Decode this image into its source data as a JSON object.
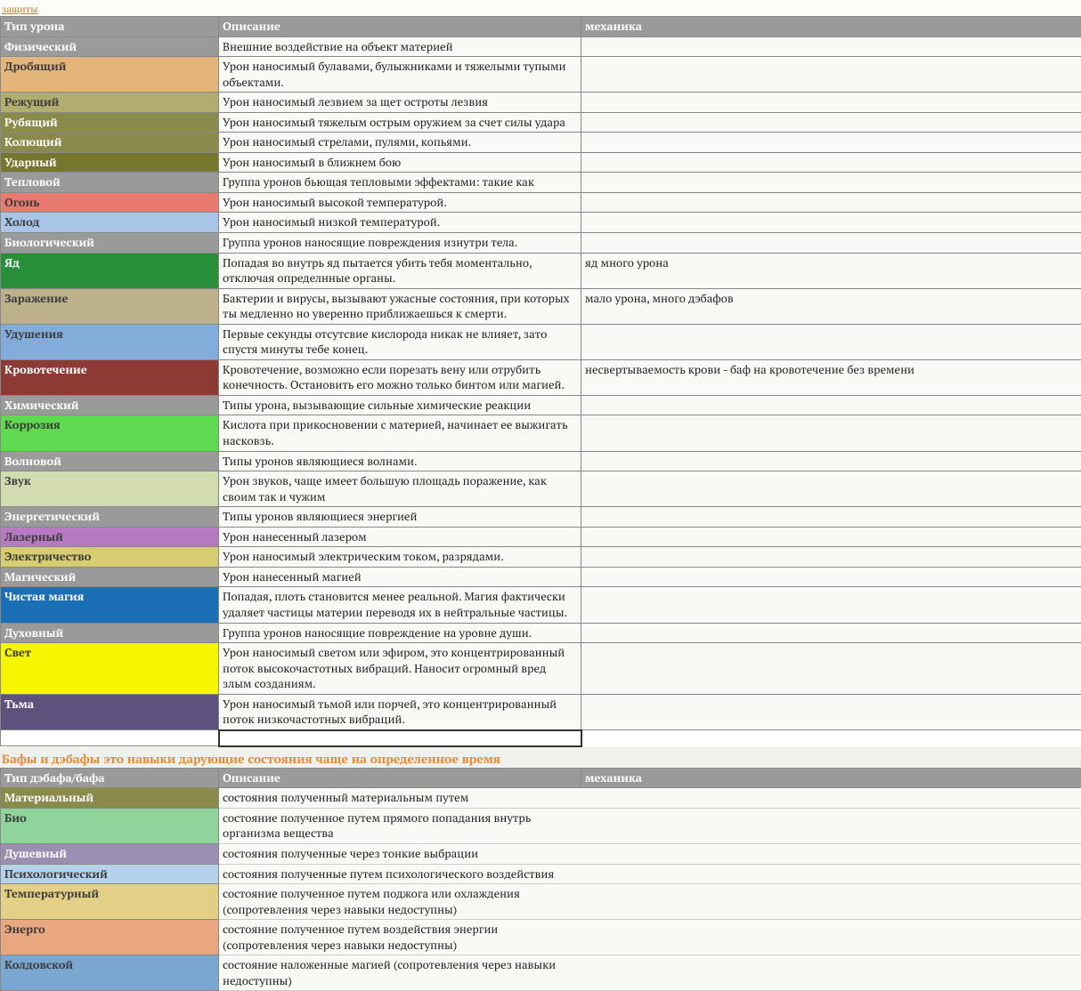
{
  "top_link": "защиты",
  "table1": {
    "headers": [
      "Тип урона",
      "Описание",
      "механика"
    ],
    "rows": [
      {
        "label": "Физический",
        "desc": "Внешние воздействие на объект материей",
        "mech": "",
        "bg": "#9a9a9a",
        "txt": "white"
      },
      {
        "label": "Дробящий",
        "desc": "Урон наносимый булавами, булыжниками и тяжелыми тупыми объектами.",
        "mech": "",
        "bg": "#e3b57a",
        "txt": "dark"
      },
      {
        "label": "Режущий",
        "desc": "Урон наносимый лезвием за щет остроты лезвия",
        "mech": "",
        "bg": "#b0ad6e",
        "txt": "dark"
      },
      {
        "label": "Рубящий",
        "desc": "Урон наносимый тяжелым острым оружием за счет силы удара",
        "mech": "",
        "bg": "#8a8a4a",
        "txt": "white"
      },
      {
        "label": "Колющий",
        "desc": "Урон наносимый стрелами, пулями, копьями.",
        "mech": "",
        "bg": "#8a8a4a",
        "txt": "white"
      },
      {
        "label": "Ударный",
        "desc": "Урон наносимый в ближнем бою",
        "mech": "",
        "bg": "#76762e",
        "txt": "white"
      },
      {
        "label": "Тепловой",
        "desc": "Группа уронов бьющая тепловыми эффектами: такие как",
        "mech": "",
        "bg": "#9a9a9a",
        "txt": "white"
      },
      {
        "label": "Огонь",
        "desc": "Урон наносимый высокой температурой.",
        "mech": "",
        "bg": "#e87a70",
        "txt": "dark"
      },
      {
        "label": "Холод",
        "desc": "Урон наносимый низкой температурой.",
        "mech": "",
        "bg": "#a8c4e6",
        "txt": "dark"
      },
      {
        "label": "Биологический",
        "desc": "Группа уронов наносящие повреждения изнутри тела.",
        "mech": "",
        "bg": "#9a9a9a",
        "txt": "white"
      },
      {
        "label": "Яд",
        "desc": "Попадая во внутрь яд пытается убить тебя моментально, отключая определнные органы.",
        "mech": "яд много урона",
        "bg": "#2a8f3a",
        "txt": "white"
      },
      {
        "label": "Заражение",
        "desc": "Бактерии и вирусы, вызывают ужасные состояния, при которых ты медленно но уверенно приближаешься к смерти.",
        "mech": "мало урона, много дэбафов",
        "bg": "#bdb18b",
        "txt": "dark"
      },
      {
        "label": "Удушения",
        "desc": "Первые секунды отсутсвие кислорода никак не влияет, зато спустя минуты тебе конец.",
        "mech": "",
        "bg": "#82acd9",
        "txt": "dark"
      },
      {
        "label": "Кровотечение",
        "desc": "Кровотечение, возможно если порезать вену или отрубить конечность. Остановить его можно только бинтом или магией.",
        "mech": "несвертываемость крови - баф на кровотечение без времени",
        "bg": "#8e3a34",
        "txt": "white"
      },
      {
        "label": "Химический",
        "desc": "Типы урона, вызывающие сильные химические реакции",
        "mech": "",
        "bg": "#9a9a9a",
        "txt": "white"
      },
      {
        "label": "Коррозия",
        "desc": "Кислота при прикосновении с материей, начинает ее выжигать насковзь.",
        "mech": "",
        "bg": "#5fd94f",
        "txt": "dark"
      },
      {
        "label": "Волновой",
        "desc": "Типы уронов являющиеся волнами.",
        "mech": "",
        "bg": "#9a9a9a",
        "txt": "white"
      },
      {
        "label": "Звук",
        "desc": "Урон звуков, чаще имеет большую площадь поражение, как своим так и чужим",
        "mech": "",
        "bg": "#d2dcb0",
        "txt": "dark"
      },
      {
        "label": "Энергетический",
        "desc": "Типы уронов являющиеся энергией",
        "mech": "",
        "bg": "#9a9a9a",
        "txt": "white"
      },
      {
        "label": "Лазерный",
        "desc": "Урон нанесенный лазером",
        "mech": "",
        "bg": "#b57ac1",
        "txt": "dark"
      },
      {
        "label": "Электричество",
        "desc": "Урон наносимый электрическим током, разрядами.",
        "mech": "",
        "bg": "#d6cc70",
        "txt": "dark"
      },
      {
        "label": "Магический",
        "desc": "Урон нанесенный магией",
        "mech": "",
        "bg": "#9a9a9a",
        "txt": "white"
      },
      {
        "label": "Чистая магия",
        "desc": "Попадая, плоть становится менее реальной. Магия фактически удаляет частицы материи переводя их в нейтральные частицы.",
        "mech": "",
        "bg": "#1a6fb5",
        "txt": "white"
      },
      {
        "label": "Духовный",
        "desc": "Группа уронов наносящие повреждение на уровне души.",
        "mech": "",
        "bg": "#9a9a9a",
        "txt": "white"
      },
      {
        "label": "Свет",
        "desc": "Урон наносимый светом или эфиром, это концентрированный поток высокочастотных вибраций. Наносит огромный вред злым созданиям.",
        "mech": "",
        "bg": "#f6f600",
        "txt": "dark"
      },
      {
        "label": "Тьма",
        "desc": "Урон наносимый тьмой или порчей, это концентрированный поток низкочастотных вибраций.",
        "mech": "",
        "bg": "#5d517d",
        "txt": "white"
      }
    ]
  },
  "section2_title": "Бафы и дэбафы это навыки дарующие состояния чаще на определенное время",
  "table2": {
    "headers": [
      "Тип дэбафа/бафа",
      "Описание",
      "механика"
    ],
    "rows": [
      {
        "label": "Материальный",
        "desc": "состояния полученный материальным путем",
        "mech": "",
        "bg": "#8a8a4a",
        "txt": "white"
      },
      {
        "label": "Био",
        "desc": "состояние полученное путем прямого попадания внутрь организма вещества",
        "mech": "",
        "bg": "#8fd49a",
        "txt": "dark"
      },
      {
        "label": "Душевный",
        "desc": "состояния полученные через тонкие выбрации",
        "mech": "",
        "bg": "#9a8fb0",
        "txt": "white"
      },
      {
        "label": "Психологический",
        "desc": "состояния полученные путем психологического воздействия",
        "mech": "",
        "bg": "#b4d3ea",
        "txt": "dark"
      },
      {
        "label": "Температурный",
        "desc": "состояние полученное путем поджога или охлаждения (сопротевления через навыки недоступны)",
        "mech": "",
        "bg": "#e3cf86",
        "txt": "dark"
      },
      {
        "label": "Энерго",
        "desc": "состояние полученное путем воздействия энергии (сопротевления через навыки недоступны)",
        "mech": "",
        "bg": "#e8a77e",
        "txt": "dark"
      },
      {
        "label": "Колдовской",
        "desc": "состояние наложенные магией (сопротевления через навыки недоступны)",
        "mech": "",
        "bg": "#7aa7d1",
        "txt": "dark"
      }
    ]
  }
}
